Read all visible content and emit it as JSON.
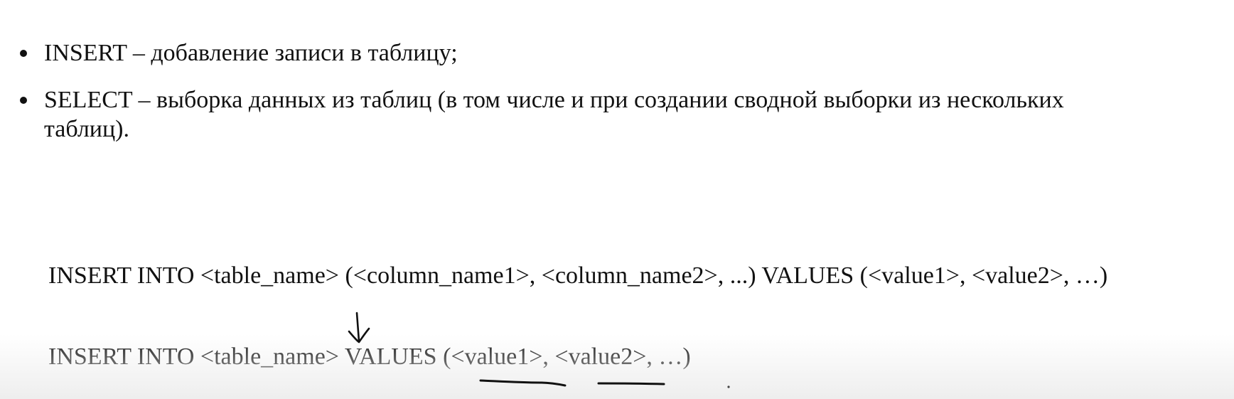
{
  "bullets": [
    {
      "text": "INSERT – добавление записи в таблицу;"
    },
    {
      "line1": "SELECT – выборка данных из таблиц (в том числе и при создании сводной выборки из нескольких",
      "line2": "таблиц)."
    }
  ],
  "syntax": {
    "full_form": "INSERT INTO <table_name> (<column_name1>, <column_name2>, ...) VALUES (<value1>, <value2>, …)",
    "short_form": "INSERT INTO <table_name> VALUES (<value1>, <value2>, …)"
  }
}
